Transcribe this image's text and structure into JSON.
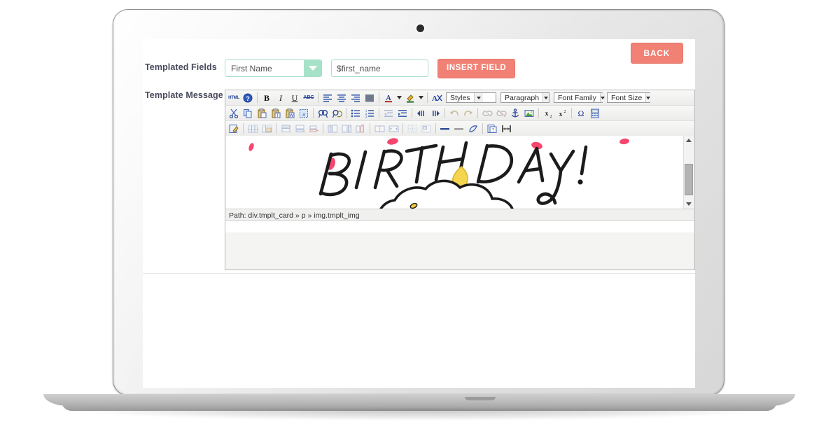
{
  "device": {
    "type": "laptop",
    "webcam_icon": "camera-icon"
  },
  "page": {
    "back_button_label": "BACK"
  },
  "form": {
    "templated_fields": {
      "label": "Templated Fields",
      "select_value": "First Name",
      "select_arrow_icon": "chevron-down-icon",
      "text_value": "$first_name",
      "text_placeholder": "$first_name",
      "insert_button_label": "INSERT FIELD"
    },
    "template_message": {
      "label": "Template Message"
    }
  },
  "editor": {
    "toolbar_row1": [
      {
        "name": "html-source-icon",
        "glyph": "HTML"
      },
      {
        "name": "help-icon",
        "glyph": "?"
      },
      {
        "name": "separator",
        "glyph": ""
      },
      {
        "name": "bold-icon",
        "glyph": "B"
      },
      {
        "name": "italic-icon",
        "glyph": "I"
      },
      {
        "name": "underline-icon",
        "glyph": "U"
      },
      {
        "name": "strikethrough-icon",
        "glyph": "ABC"
      },
      {
        "name": "separator",
        "glyph": ""
      },
      {
        "name": "align-left-icon",
        "glyph": ""
      },
      {
        "name": "align-center-icon",
        "glyph": ""
      },
      {
        "name": "align-right-icon",
        "glyph": ""
      },
      {
        "name": "align-justify-icon",
        "glyph": ""
      },
      {
        "name": "separator",
        "glyph": ""
      },
      {
        "name": "text-color-icon",
        "glyph": "A"
      },
      {
        "name": "text-color-dropdown-icon",
        "glyph": ""
      },
      {
        "name": "background-color-icon",
        "glyph": ""
      },
      {
        "name": "background-color-dropdown-icon",
        "glyph": ""
      },
      {
        "name": "separator",
        "glyph": ""
      },
      {
        "name": "remove-format-icon",
        "glyph": "A"
      }
    ],
    "dropdowns": [
      {
        "name": "styles-dropdown",
        "label": "Styles"
      },
      {
        "name": "paragraph-dropdown",
        "label": "Paragraph"
      },
      {
        "name": "font-family-dropdown",
        "label": "Font Family"
      },
      {
        "name": "font-size-dropdown",
        "label": "Font Size"
      }
    ],
    "toolbar_row2": [
      {
        "name": "cut-icon"
      },
      {
        "name": "copy-icon"
      },
      {
        "name": "paste-icon"
      },
      {
        "name": "paste-as-text-icon"
      },
      {
        "name": "paste-from-word-icon"
      },
      {
        "name": "select-all-icon"
      },
      {
        "name": "separator"
      },
      {
        "name": "find-icon"
      },
      {
        "name": "find-replace-icon"
      },
      {
        "name": "separator"
      },
      {
        "name": "bullet-list-icon"
      },
      {
        "name": "numbered-list-icon"
      },
      {
        "name": "separator"
      },
      {
        "name": "outdent-icon"
      },
      {
        "name": "indent-icon"
      },
      {
        "name": "separator"
      },
      {
        "name": "ltr-direction-icon"
      },
      {
        "name": "rtl-direction-icon"
      },
      {
        "name": "separator"
      },
      {
        "name": "undo-icon"
      },
      {
        "name": "redo-icon"
      },
      {
        "name": "separator"
      },
      {
        "name": "link-icon"
      },
      {
        "name": "unlink-icon"
      },
      {
        "name": "anchor-icon"
      },
      {
        "name": "insert-image-icon"
      },
      {
        "name": "separator"
      },
      {
        "name": "subscript-icon"
      },
      {
        "name": "superscript-icon"
      },
      {
        "name": "separator"
      },
      {
        "name": "special-character-icon"
      },
      {
        "name": "calculator-icon"
      }
    ],
    "toolbar_row3": [
      {
        "name": "edit-css-icon"
      },
      {
        "name": "separator"
      },
      {
        "name": "insert-table-icon"
      },
      {
        "name": "table-properties-icon"
      },
      {
        "name": "separator"
      },
      {
        "name": "insert-row-before-icon"
      },
      {
        "name": "insert-row-after-icon"
      },
      {
        "name": "delete-row-icon"
      },
      {
        "name": "separator"
      },
      {
        "name": "insert-column-before-icon"
      },
      {
        "name": "insert-column-after-icon"
      },
      {
        "name": "delete-column-icon"
      },
      {
        "name": "separator"
      },
      {
        "name": "split-cell-icon"
      },
      {
        "name": "merge-cell-icon"
      },
      {
        "name": "separator"
      },
      {
        "name": "horizontal-rule-icon"
      },
      {
        "name": "page-break-icon"
      },
      {
        "name": "cleanup-icon"
      },
      {
        "name": "separator"
      },
      {
        "name": "preview-icon"
      },
      {
        "name": "fullscreen-icon"
      }
    ],
    "path_bar": {
      "label": "Path: div.tmplt_card » p » img.tmplt_img"
    },
    "scrollbar": {
      "up_arrow_icon": "triangle-up-icon",
      "down_arrow_icon": "triangle-down-icon",
      "thumb_name": "scrollbar-thumb"
    },
    "content": {
      "artwork_name": "birthday-cupcake-illustration",
      "headline_text": "BIRTHDAY!",
      "alt": "Hand drawn BIRTHDAY! text above a cupcake with a lit candle and sprinkles"
    }
  },
  "colors": {
    "accent_coral": "#f08174",
    "accent_mint": "#a6e2c8",
    "input_border_mint": "#a6ddc8",
    "label_text": "#47495a",
    "toolbar_icon_blue": "#21409a",
    "candle_flame": "#f5d44f",
    "candle_stripe": "#ef4f72",
    "cup_blue": "#bcd9e8",
    "sprinkle_green": "#6fbf59",
    "sprinkle_yellow": "#f2c93c",
    "confetti_pink": "#f5466e"
  }
}
